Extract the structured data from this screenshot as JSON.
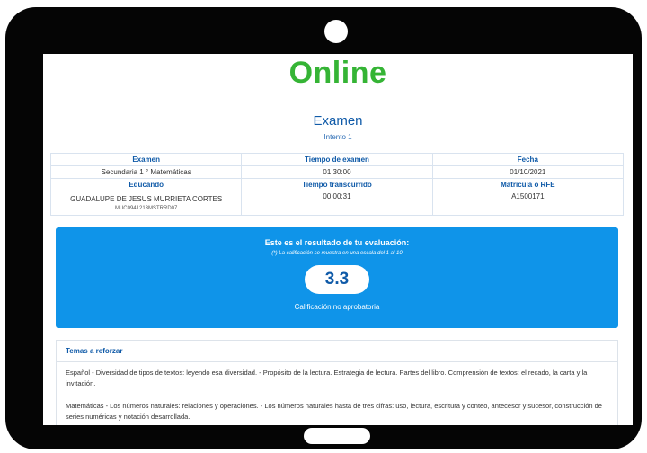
{
  "brand": {
    "logo_text": "Online",
    "logo_color": "#35b435"
  },
  "exam": {
    "title": "Examen",
    "attempt": "Intento 1"
  },
  "info_table": {
    "headers_row1": [
      "Examen",
      "Tiempo de examen",
      "Fecha"
    ],
    "values_row1": [
      "Secundaria 1 ° Matemáticas",
      "01:30:00",
      "01/10/2021"
    ],
    "headers_row2": [
      "Educando",
      "Tiempo transcurrido",
      "Matrícula o RFE"
    ],
    "student_name": "GUADALUPE DE JESUS MURRIETA CORTES",
    "student_curp": "MUC0941213MSTRRD07",
    "elapsed": "00:00:31",
    "enrollment": "A1500171"
  },
  "result": {
    "heading": "Este es el resultado de tu evaluación:",
    "scale_note": "(*) La calificación se muestra en una escala del 1 al 10",
    "score": "3.3",
    "status": "Calificación no aprobatoria",
    "accent": "#0f94e9"
  },
  "topics": {
    "heading": "Temas a reforzar",
    "items": [
      "Español - Diversidad de tipos de textos: leyendo esa diversidad. - Propósito de la lectura. Estrategia de lectura. Partes del libro. Comprensión de textos: el recado, la carta y la invitación.",
      "Matemáticas - Los números naturales: relaciones y operaciones. - Los números naturales hasta de tres cifras: uso, lectura, escritura y conteo, antecesor y sucesor, construcción de series numéricas y notación desarrollada."
    ]
  }
}
